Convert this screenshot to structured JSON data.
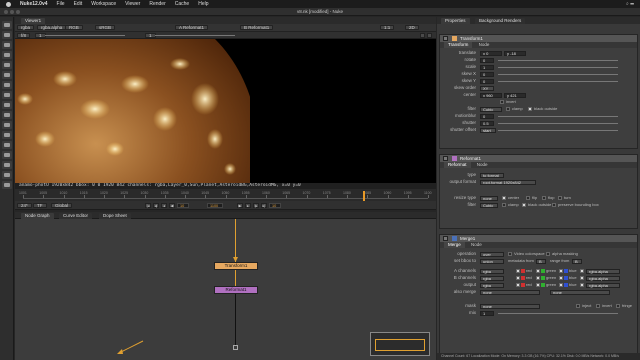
{
  "menubar": {
    "app_name": "Nuke12.0v4",
    "items": [
      "File",
      "Edit",
      "Workspace",
      "Viewer",
      "Render",
      "Cache",
      "Help"
    ],
    "right_text": "⌕ ☰"
  },
  "window": {
    "title": "v8.nk [modified] - Nuke"
  },
  "viewer": {
    "tab_label": "Viewer1",
    "controls1": {
      "layer": "rgba",
      "channel": "rgba.alpha",
      "colorspace_a": "RGB",
      "colorspace_b": "sRGB",
      "input_a": "A  Reformat1",
      "input_b": "B  Reformat1",
      "proxy": "1:1",
      "mode": "2D"
    },
    "controls2": {
      "fstop": "f/8",
      "gain": "1",
      "gamma": "1"
    },
    "info_text": "anamo-photO 1920x842  bbox: 0 0 1920 842 channels: rgba,Layer_0,Sun,Planet,AsteroidBG,AsteroidMG,  x=0 y=0"
  },
  "timeline": {
    "tick_labels": [
      "1001",
      "1005",
      "1010",
      "1015",
      "1020",
      "1025",
      "1030",
      "1035",
      "1040",
      "1045",
      "1050",
      "1055",
      "1060",
      "1065",
      "1070",
      "1075",
      "1080",
      "1085",
      "1090",
      "1095",
      "1100"
    ],
    "current_frame": "1100",
    "fps": "24*",
    "tc_mode": "TF",
    "global_label": "Global",
    "in_point": "10",
    "out_point": "10"
  },
  "node_graph": {
    "tabs": [
      "Node Graph",
      "Curve Editor",
      "Dope Sheet"
    ],
    "nodes": [
      {
        "label": "Transform1",
        "color": "#e6a860"
      },
      {
        "label": "Reformat1",
        "color": "#b070c0"
      }
    ],
    "accent_color": "#e0a030"
  },
  "properties": {
    "tabs": [
      "Properties",
      "Background Renders"
    ],
    "transform_panel": {
      "title": "Transform1",
      "subtabs": [
        "Transform",
        "Node"
      ],
      "color": "#e6a860",
      "knobs": [
        {
          "label": "translate",
          "value": "x  0",
          "value2": "y  -18"
        },
        {
          "label": "rotate",
          "value": "0"
        },
        {
          "label": "scale",
          "value": "1"
        },
        {
          "label": "skew X",
          "value": "0"
        },
        {
          "label": "skew Y",
          "value": "0"
        },
        {
          "label": "skew order",
          "value": "XY"
        },
        {
          "label": "center",
          "value": "x  960",
          "value2": "y  421"
        },
        {
          "label": "",
          "value": "invert"
        },
        {
          "label": "filter",
          "value": "Cubic",
          "extra1": "clamp",
          "extra2": "black outside"
        },
        {
          "label": "motionblur",
          "value": "0"
        },
        {
          "label": "shutter",
          "value": "0.5"
        },
        {
          "label": "shutter offset",
          "value": "start"
        }
      ]
    },
    "reformat_panel": {
      "title": "Reformat1",
      "subtabs": [
        "Reformat",
        "Node"
      ],
      "color": "#b070c0",
      "knobs": [
        {
          "label": "type",
          "value": "to format"
        },
        {
          "label": "output format",
          "value": "root.format 1920x842"
        },
        {
          "label": "resize type",
          "value": "none",
          "flags": [
            "center",
            "flip",
            "flop",
            "turn"
          ]
        },
        {
          "label": "filter",
          "value": "Cubic",
          "flags": [
            "clamp",
            "black outside",
            "preserve bounding box"
          ]
        }
      ]
    },
    "merge_panel": {
      "title": "Merge1",
      "subtabs": [
        "Merge",
        "Node"
      ],
      "color": "#4a70b8",
      "knobs": [
        {
          "label": "operation",
          "value": "over",
          "extra": "Video colorspace",
          "extra2": "alpha masking"
        },
        {
          "label": "set bbox to",
          "value": "union",
          "extra": "metadata from",
          "extra2": "B",
          "extra3": "range from",
          "extra4": "B"
        },
        {
          "label": "A channels",
          "value": "rgba",
          "chans": [
            "red",
            "green",
            "blue",
            "rgba.alpha"
          ]
        },
        {
          "label": "B channels",
          "value": "rgba",
          "chans": [
            "red",
            "green",
            "blue",
            "rgba.alpha"
          ]
        },
        {
          "label": "output",
          "value": "rgba",
          "chans": [
            "red",
            "green",
            "blue",
            "rgba.alpha"
          ]
        },
        {
          "label": "also merge",
          "value": "none",
          "value2": "none"
        },
        {
          "label": "mask",
          "value": "none",
          "flags": [
            "inject",
            "invert",
            "fringe"
          ]
        },
        {
          "label": "mix",
          "value": "1"
        }
      ]
    },
    "statusbar_text": "Channel Count: 67  Localization Mode: On  Memory: 3.3 GB (16.7%)  CPU: 32.1%  Disk: 0.0 MB/s  Network: 0.0 MB/s"
  }
}
